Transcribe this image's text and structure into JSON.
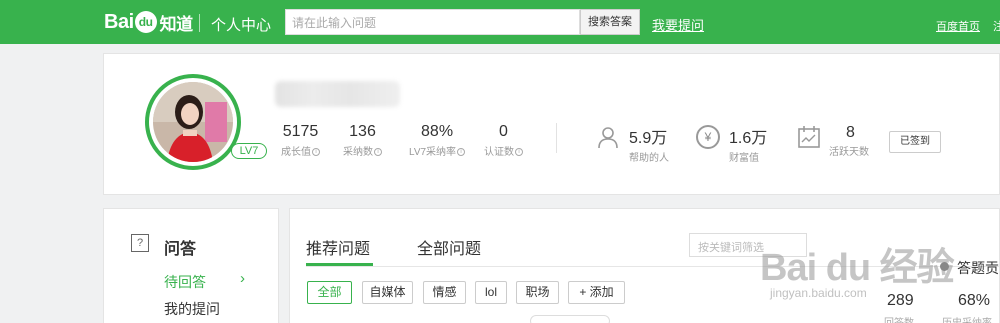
{
  "header": {
    "logo_text": "Bai",
    "logo_paw": "du",
    "logo_suffix": "知道",
    "center_title": "个人中心",
    "search_placeholder": "请在此输入问题",
    "search_button": "搜索答案",
    "ask_link": "我要提问",
    "home_link": "百度首页",
    "cut_link": "注"
  },
  "profile": {
    "level_badge": "LV7",
    "stats": [
      {
        "value": "5175",
        "label": "成长值"
      },
      {
        "value": "136",
        "label": "采纳数"
      },
      {
        "value": "88%",
        "label": "LV7采纳率"
      },
      {
        "value": "0",
        "label": "认证数"
      }
    ],
    "info_glyph": "i",
    "helped": {
      "value": "5.9万",
      "label": "帮助的人"
    },
    "wealth": {
      "value": "1.6万",
      "label": "财富值"
    },
    "active_days": {
      "value": "8",
      "label": "活跃天数"
    },
    "signed_button": "已签到"
  },
  "sidebar": {
    "qa_icon": "?",
    "title": "问答",
    "active_item": "待回答",
    "active_arrow": "›",
    "item2": "我的提问"
  },
  "main": {
    "tabs": [
      "推荐问题",
      "全部问题"
    ],
    "filter_placeholder": "按关键词筛选",
    "chips": [
      "全部",
      "自媒体",
      "情感",
      "lol",
      "职场",
      "+ 添加"
    ]
  },
  "watermark": {
    "main": "Bai du 经验",
    "sub": "jingyan.baidu.com"
  },
  "right_stats": {
    "title": "答题贡",
    "answers": {
      "value": "289",
      "label": "回答数"
    },
    "adoption": {
      "value": "68%",
      "label": "历史采纳率"
    }
  },
  "colors": {
    "brand_green": "#38b24d"
  }
}
